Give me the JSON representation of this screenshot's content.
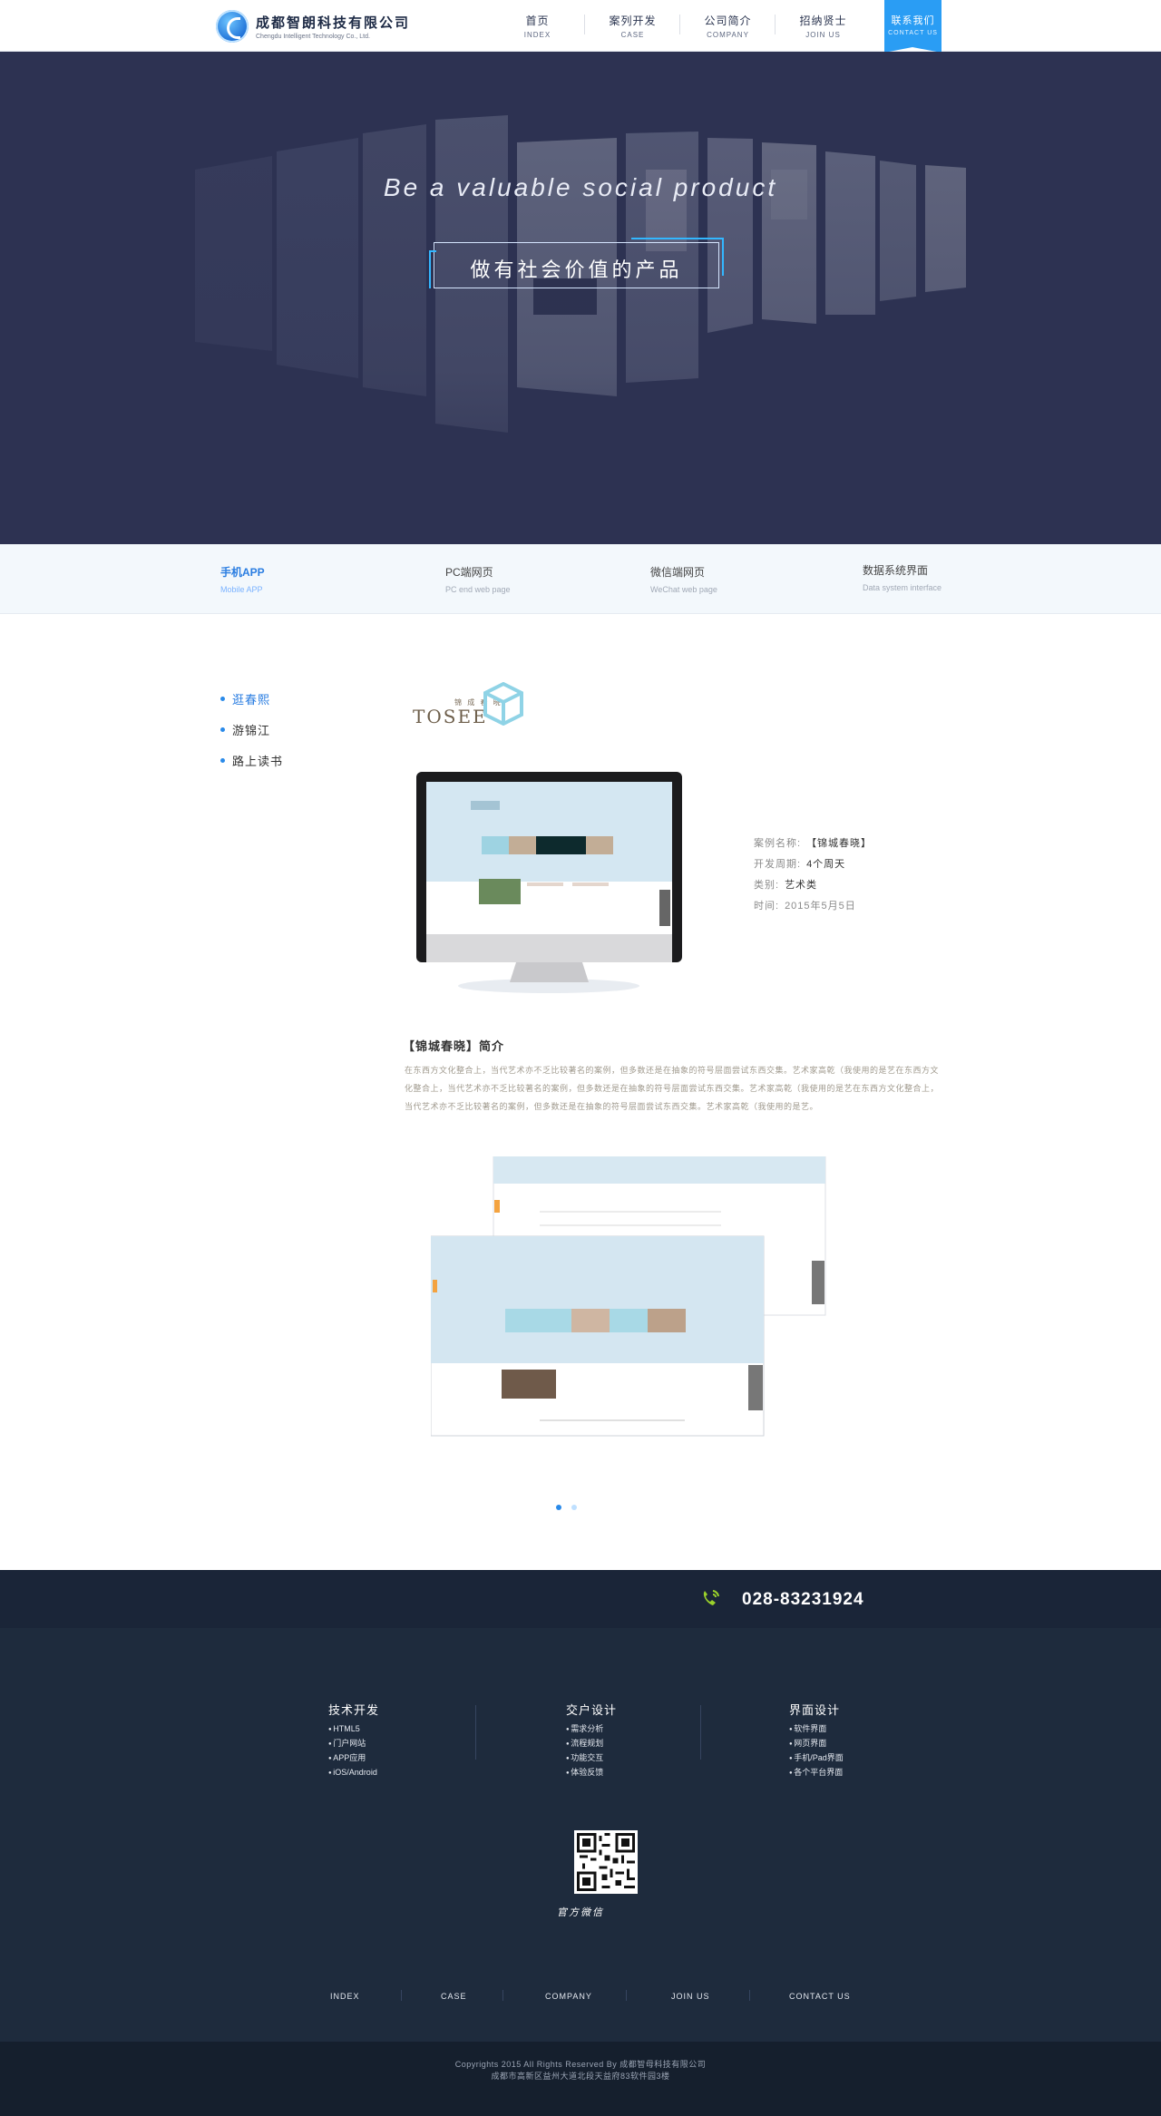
{
  "header": {
    "logo_cn": "成都智朗科技有限公司",
    "logo_en": "Chengdu Intelligent Technology Co., Ltd.",
    "nav": [
      {
        "cn": "首页",
        "en": "INDEX"
      },
      {
        "cn": "案列开发",
        "en": "CASE"
      },
      {
        "cn": "公司简介",
        "en": "COMPANY"
      },
      {
        "cn": "招纳贤士",
        "en": "JOIN US"
      }
    ],
    "contact": {
      "cn": "联系我们",
      "en": "CONTACT US"
    }
  },
  "hero": {
    "tagline_en": "Be a valuable social product",
    "tagline_cn": "做有社会价值的产品"
  },
  "tabs": [
    {
      "cn": "手机APP",
      "en": "Mobile APP"
    },
    {
      "cn": "PC端网页",
      "en": "PC end web page"
    },
    {
      "cn": "微信端网页",
      "en": "WeChat web page"
    },
    {
      "cn": "数据系统界面",
      "en": "Data system interface"
    }
  ],
  "sidebar": {
    "items": [
      "逛春熙",
      "游锦江",
      "路上读书"
    ]
  },
  "case": {
    "brand_small": "锦 成 春 晓",
    "brand_big": "TOSEE",
    "info": [
      {
        "label": "案例名称:",
        "value": "【锦城春晓】"
      },
      {
        "label": "开发周期:",
        "value": "4个周天"
      },
      {
        "label": "类别:",
        "value": "艺术类"
      },
      {
        "label": "时间:",
        "value": "2015年5月5日"
      }
    ],
    "intro_title": "【锦城春晓】简介",
    "intro_text": "在东西方文化整合上，当代艺术亦不乏比较著名的案例，但多数还是在抽象的符号层面尝试东西交集。艺术家高乾（我使用的是艺在东西方文化整合上，当代艺术亦不乏比较著名的案例，但多数还是在抽象的符号层面尝试东西交集。艺术家高乾（我使用的是艺在东西方文化整合上，当代艺术亦不乏比较著名的案例，但多数还是在抽象的符号层面尝试东西交集。艺术家高乾（我使用的是艺。"
  },
  "phone": {
    "number": "028-83231924"
  },
  "footer": {
    "columns": [
      {
        "title": "技术开发",
        "items": [
          "HTML5",
          "门户网站",
          "APP应用",
          "iOS/Android"
        ]
      },
      {
        "title": "交户设计",
        "items": [
          "需求分析",
          "流程规划",
          "功能交互",
          "体验反馈"
        ]
      },
      {
        "title": "界面设计",
        "items": [
          "软件界面",
          "网页界面",
          "手机/Pad界面",
          "各个平台界面"
        ]
      }
    ],
    "qr_caption": "官方微信",
    "nav": [
      "INDEX",
      "CASE",
      "COMPANY",
      "JOIN US",
      "CONTACT US"
    ],
    "copyright": "Copyrights 2015 All Rights Reserved By 成都智母科技有限公司",
    "address": "成都市高新区益州大道北段天益府83软件园3楼"
  },
  "colors": {
    "accent": "#2a9df4",
    "hero_bg": "#2d3252",
    "footer_bg": "#1e2b3d",
    "phone_bar": "#1a2538"
  }
}
